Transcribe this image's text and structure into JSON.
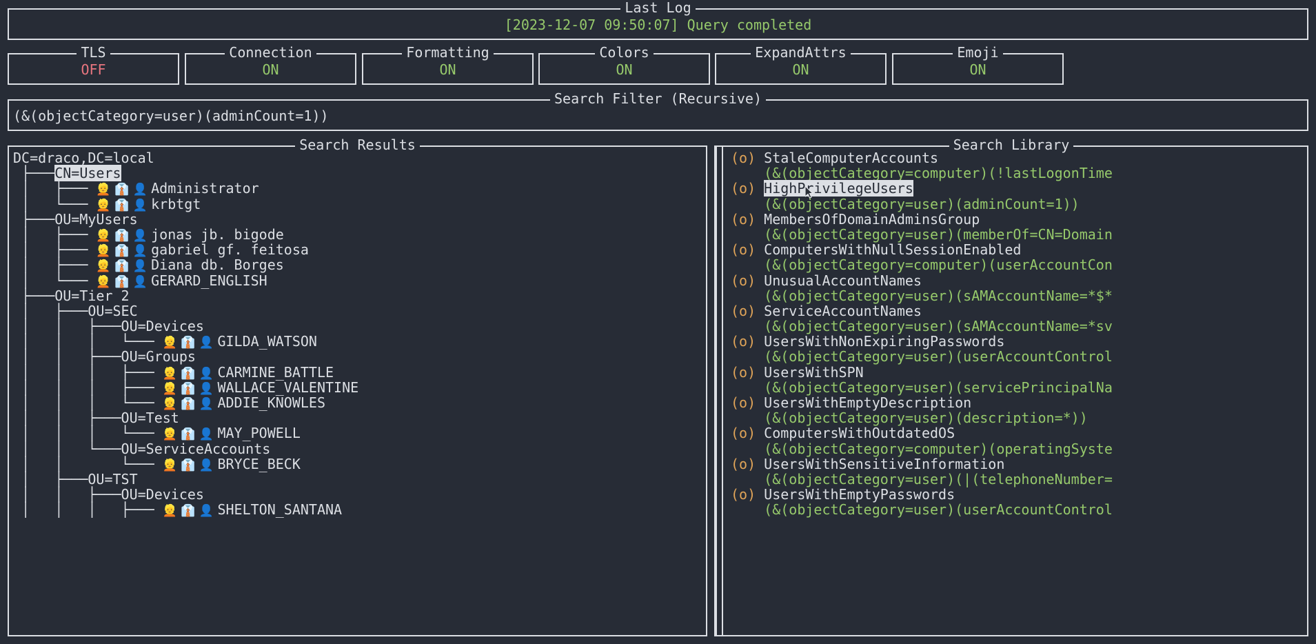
{
  "log": {
    "title": "Last Log",
    "text": "[2023-12-07 09:50:07] Query completed"
  },
  "toggles": [
    {
      "title": "TLS",
      "value": "OFF",
      "state": "off"
    },
    {
      "title": "Connection",
      "value": "ON",
      "state": "on"
    },
    {
      "title": "Formatting",
      "value": "ON",
      "state": "on"
    },
    {
      "title": "Colors",
      "value": "ON",
      "state": "on"
    },
    {
      "title": "ExpandAttrs",
      "value": "ON",
      "state": "on"
    },
    {
      "title": "Emoji",
      "value": "ON",
      "state": "on"
    }
  ],
  "filter": {
    "title": "Search Filter (Recursive)",
    "value": "(&(objectCategory=user)(adminCount=1))"
  },
  "results": {
    "title": "Search Results",
    "lines": [
      {
        "prefix": "DC=draco,DC=local",
        "name": "",
        "emoji": "",
        "selected": false
      },
      {
        "prefix": " ├───",
        "name": "CN=Users",
        "emoji": "",
        "selected": true
      },
      {
        "prefix": " │   ├─── ",
        "name": "Administrator",
        "emoji": "👱 👔 👤",
        "selected": false
      },
      {
        "prefix": " │   └─── ",
        "name": "krbtgt",
        "emoji": "👱 👔 👤",
        "selected": false
      },
      {
        "prefix": " ├───",
        "name": "OU=MyUsers",
        "emoji": "",
        "selected": false
      },
      {
        "prefix": " │   ├─── ",
        "name": "jonas jb. bigode",
        "emoji": "👱 👔 👤",
        "selected": false
      },
      {
        "prefix": " │   ├─── ",
        "name": "gabriel gf. feitosa",
        "emoji": "👱 👔 👤",
        "selected": false
      },
      {
        "prefix": " │   ├─── ",
        "name": "Diana db. Borges",
        "emoji": "👱 👔 👤",
        "selected": false
      },
      {
        "prefix": " │   └─── ",
        "name": "GERARD_ENGLISH",
        "emoji": "👱 👔 👤",
        "selected": false
      },
      {
        "prefix": " ├───",
        "name": "OU=Tier 2",
        "emoji": "",
        "selected": false
      },
      {
        "prefix": " │   ├───",
        "name": "OU=SEC",
        "emoji": "",
        "selected": false
      },
      {
        "prefix": " │   │   ├───",
        "name": "OU=Devices",
        "emoji": "",
        "selected": false
      },
      {
        "prefix": " │   │   │   └─── ",
        "name": "GILDA_WATSON",
        "emoji": "👱 👔 👤",
        "selected": false
      },
      {
        "prefix": " │   │   ├───",
        "name": "OU=Groups",
        "emoji": "",
        "selected": false
      },
      {
        "prefix": " │   │   │   ├─── ",
        "name": "CARMINE_BATTLE",
        "emoji": "👱 👔 👤",
        "selected": false
      },
      {
        "prefix": " │   │   │   ├─── ",
        "name": "WALLACE_VALENTINE",
        "emoji": "👱 👔 👤",
        "selected": false
      },
      {
        "prefix": " │   │   │   └─── ",
        "name": "ADDIE_KNOWLES",
        "emoji": "👱 👔 👤",
        "selected": false
      },
      {
        "prefix": " │   │   ├───",
        "name": "OU=Test",
        "emoji": "",
        "selected": false
      },
      {
        "prefix": " │   │   │   └─── ",
        "name": "MAY_POWELL",
        "emoji": "👱 👔 👤",
        "selected": false
      },
      {
        "prefix": " │   │   └───",
        "name": "OU=ServiceAccounts",
        "emoji": "",
        "selected": false
      },
      {
        "prefix": " │   │       └─── ",
        "name": "BRYCE_BECK",
        "emoji": "👱 👔 👤",
        "selected": false
      },
      {
        "prefix": " │   ├───",
        "name": "OU=TST",
        "emoji": "",
        "selected": false
      },
      {
        "prefix": " │   │   ├───",
        "name": "OU=Devices",
        "emoji": "",
        "selected": false
      },
      {
        "prefix": " │   │   │   ├─── ",
        "name": "SHELTON_SANTANA",
        "emoji": "👱 👔 👤",
        "selected": false
      }
    ]
  },
  "library": {
    "title": "Search Library",
    "bullet": "(o)",
    "entries": [
      {
        "name": "StaleComputerAccounts",
        "filter": "(&(objectCategory=computer)(!lastLogonTime",
        "highlighted": false
      },
      {
        "name": "HighPrivilegeUsers",
        "filter": "(&(objectCategory=user)(adminCount=1))",
        "highlighted": true
      },
      {
        "name": "MembersOfDomainAdminsGroup",
        "filter": "(&(objectCategory=user)(memberOf=CN=Domain",
        "highlighted": false
      },
      {
        "name": "ComputersWithNullSessionEnabled",
        "filter": "(&(objectCategory=computer)(userAccountCon",
        "highlighted": false
      },
      {
        "name": "UnusualAccountNames",
        "filter": "(&(objectCategory=user)(sAMAccountName=*$*",
        "highlighted": false
      },
      {
        "name": "ServiceAccountNames",
        "filter": "(&(objectCategory=user)(sAMAccountName=*sv",
        "highlighted": false
      },
      {
        "name": "UsersWithNonExpiringPasswords",
        "filter": "(&(objectCategory=user)(userAccountControl",
        "highlighted": false
      },
      {
        "name": "UsersWithSPN",
        "filter": "(&(objectCategory=user)(servicePrincipalNa",
        "highlighted": false
      },
      {
        "name": "UsersWithEmptyDescription",
        "filter": "(&(objectCategory=user)(description=*))",
        "highlighted": false
      },
      {
        "name": "ComputersWithOutdatedOS",
        "filter": "(&(objectCategory=computer)(operatingSyste",
        "highlighted": false
      },
      {
        "name": "UsersWithSensitiveInformation",
        "filter": "(&(objectCategory=user)(|(telephoneNumber=",
        "highlighted": false
      },
      {
        "name": "UsersWithEmptyPasswords",
        "filter": "(&(objectCategory=user)(userAccountControl",
        "highlighted": false
      }
    ]
  },
  "colors": {
    "background": "#272c36",
    "border": "#dcdfe4",
    "text": "#dcdfe4",
    "green": "#96c96b",
    "red": "#e8757f",
    "orange": "#e0a458",
    "highlight_bg": "#dcdfe4",
    "highlight_fg": "#272c36"
  }
}
